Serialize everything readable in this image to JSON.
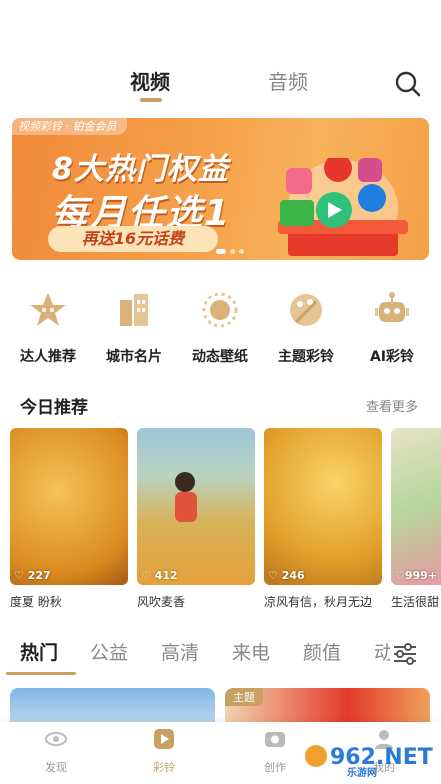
{
  "top_tabs": {
    "video": "视频",
    "audio": "音频"
  },
  "banner": {
    "tag": "视频彩铃 · 铂金会员",
    "line1": "8大热门权益",
    "line2": "每月任选1",
    "pill": "再送16元话费"
  },
  "categories": [
    {
      "label": "达人推荐",
      "icon": "star-face-icon"
    },
    {
      "label": "城市名片",
      "icon": "city-building-icon"
    },
    {
      "label": "动态壁纸",
      "icon": "sun-wallpaper-icon"
    },
    {
      "label": "主题彩铃",
      "icon": "palette-icon"
    },
    {
      "label": "AI彩铃",
      "icon": "robot-icon"
    }
  ],
  "today": {
    "title": "今日推荐",
    "more": "查看更多",
    "cards": [
      {
        "likes": "227",
        "caption": "度夏 盼秋"
      },
      {
        "likes": "412",
        "caption": "风吹麦香"
      },
      {
        "likes": "246",
        "caption": "凉风有信，秋月无边"
      },
      {
        "likes": "999+",
        "caption": "生活很甜"
      }
    ]
  },
  "feed_tabs": [
    "热门",
    "公益",
    "高清",
    "来电",
    "颜值",
    "动"
  ],
  "preview_badge": "主题",
  "nav": [
    {
      "label": "发现",
      "icon": "eye-icon"
    },
    {
      "label": "彩铃",
      "icon": "play-icon"
    },
    {
      "label": "创作",
      "icon": "camera-icon"
    },
    {
      "label": "我的",
      "icon": "user-icon"
    }
  ],
  "watermark": "962.NET",
  "watermark_sub": "乐游网",
  "colors": {
    "accent": "#c8a062",
    "banner_orange": "#f08a3a"
  }
}
